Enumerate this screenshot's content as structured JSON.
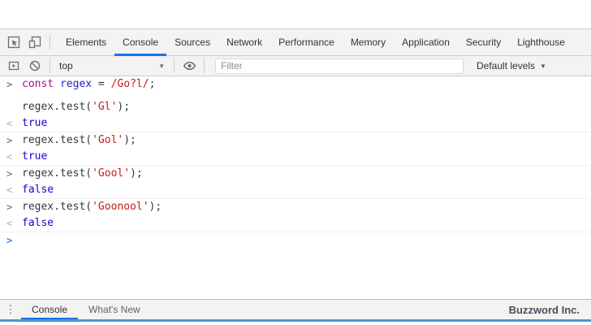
{
  "tabbar": {
    "tabs": [
      {
        "label": "Elements",
        "active": false
      },
      {
        "label": "Console",
        "active": true
      },
      {
        "label": "Sources",
        "active": false
      },
      {
        "label": "Network",
        "active": false
      },
      {
        "label": "Performance",
        "active": false
      },
      {
        "label": "Memory",
        "active": false
      },
      {
        "label": "Application",
        "active": false
      },
      {
        "label": "Security",
        "active": false
      },
      {
        "label": "Lighthouse",
        "active": false
      }
    ]
  },
  "toolbar": {
    "context": "top",
    "filter_placeholder": "Filter",
    "levels": "Default levels"
  },
  "icons": {
    "caret_down": "▼",
    "kebab": "⋮",
    "inspect": "cursor-in-box",
    "device_toolbar": "phone-tablet",
    "console_sidebar": "panel-toggle",
    "clear_console": "circle-slash",
    "eye": "live-expression-eye"
  },
  "console": {
    "prompt_char": ">",
    "result_char": "<",
    "groups": [
      {
        "command_lines": [
          [
            {
              "t": "const",
              "c": "keyword"
            },
            {
              "t": " ",
              "c": "plain"
            },
            {
              "t": "regex",
              "c": "def"
            },
            {
              "t": " = ",
              "c": "plain"
            },
            {
              "t": "/Go?l/",
              "c": "regex"
            },
            {
              "t": ";",
              "c": "plain"
            }
          ],
          [],
          [
            {
              "t": "regex.test(",
              "c": "plain"
            },
            {
              "t": "'Gl'",
              "c": "string"
            },
            {
              "t": ");",
              "c": "plain"
            }
          ]
        ],
        "result": [
          {
            "t": "true",
            "c": "boolean"
          }
        ]
      },
      {
        "command_lines": [
          [
            {
              "t": "regex.test(",
              "c": "plain"
            },
            {
              "t": "'Gol'",
              "c": "string"
            },
            {
              "t": ");",
              "c": "plain"
            }
          ]
        ],
        "result": [
          {
            "t": "true",
            "c": "boolean"
          }
        ]
      },
      {
        "command_lines": [
          [
            {
              "t": "regex.test(",
              "c": "plain"
            },
            {
              "t": "'Gool'",
              "c": "string"
            },
            {
              "t": ");",
              "c": "plain"
            }
          ]
        ],
        "result": [
          {
            "t": "false",
            "c": "boolean"
          }
        ]
      },
      {
        "command_lines": [
          [
            {
              "t": "regex.test(",
              "c": "plain"
            },
            {
              "t": "'Goonool'",
              "c": "string"
            },
            {
              "t": ");",
              "c": "plain"
            }
          ]
        ],
        "result": [
          {
            "t": "false",
            "c": "boolean"
          }
        ]
      }
    ]
  },
  "drawer": {
    "tabs": [
      {
        "label": "Console",
        "active": true
      },
      {
        "label": "What's New",
        "active": false
      }
    ],
    "watermark": "Buzzword Inc."
  },
  "colors": {
    "plain": "#303942",
    "keyword": "#aa0d91",
    "def": "#2222cc",
    "string": "#c41a16",
    "regex": "#c41a16",
    "boolean": "#1c00cf",
    "prompt_history": "#5f6368",
    "prompt_active": "#367cf2",
    "result_arrow": "#adadad",
    "accent": "#1a73e8",
    "bottom_bar": "#4f94d0"
  }
}
